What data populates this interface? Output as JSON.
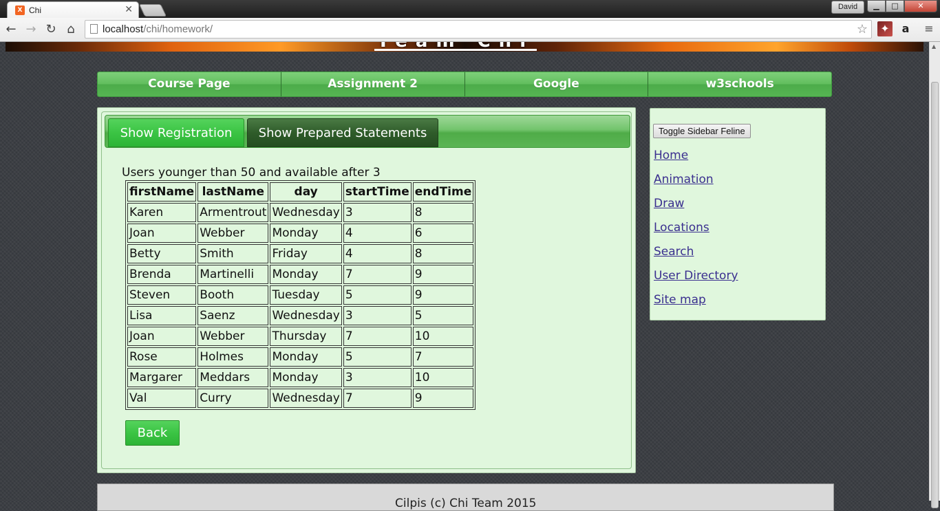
{
  "browser": {
    "tab_title": "Chi",
    "tab_favicon": "xampp-icon",
    "user_name": "David",
    "url_host": "localhost",
    "url_path": "/chi/homework/",
    "window_controls": {
      "minimize": "▁",
      "maximize": "□",
      "close": "✕"
    }
  },
  "banner": {
    "title": "Team Chi"
  },
  "navbar": {
    "items": [
      {
        "label": "Course Page"
      },
      {
        "label": "Assignment 2"
      },
      {
        "label": "Google"
      },
      {
        "label": "w3schools"
      }
    ]
  },
  "main": {
    "tabs": [
      {
        "label": "Show Registration",
        "active": true
      },
      {
        "label": "Show Prepared Statements",
        "active": false
      }
    ],
    "result_title": "Users younger than 50 and available after 3",
    "table": {
      "headers": [
        "firstName",
        "lastName",
        "day",
        "startTime",
        "endTime"
      ],
      "rows": [
        [
          "Karen",
          "Armentrout",
          "Wednesday",
          "3",
          "8"
        ],
        [
          "Joan",
          "Webber",
          "Monday",
          "4",
          "6"
        ],
        [
          "Betty",
          "Smith",
          "Friday",
          "4",
          "8"
        ],
        [
          "Brenda",
          "Martinelli",
          "Monday",
          "7",
          "9"
        ],
        [
          "Steven",
          "Booth",
          "Tuesday",
          "5",
          "9"
        ],
        [
          "Lisa",
          "Saenz",
          "Wednesday",
          "3",
          "5"
        ],
        [
          "Joan",
          "Webber",
          "Thursday",
          "7",
          "10"
        ],
        [
          "Rose",
          "Holmes",
          "Monday",
          "5",
          "7"
        ],
        [
          "Margarer",
          "Meddars",
          "Monday",
          "3",
          "10"
        ],
        [
          "Val",
          "Curry",
          "Wednesday",
          "7",
          "9"
        ]
      ]
    },
    "back_label": "Back"
  },
  "sidebar": {
    "toggle_label": "Toggle Sidebar Feline",
    "links": [
      {
        "label": "Home"
      },
      {
        "label": "Animation"
      },
      {
        "label": "Draw"
      },
      {
        "label": "Locations"
      },
      {
        "label": "Search"
      },
      {
        "label": "User Directory"
      },
      {
        "label": "Site map"
      }
    ]
  },
  "footer": {
    "text": "Cilpis (c) Chi Team 2015"
  },
  "colors": {
    "accent_green": "#3bc444",
    "dark_tab": "#2f5c2a",
    "panel_bg": "#e0f7dd",
    "link": "#3a2f8f"
  }
}
